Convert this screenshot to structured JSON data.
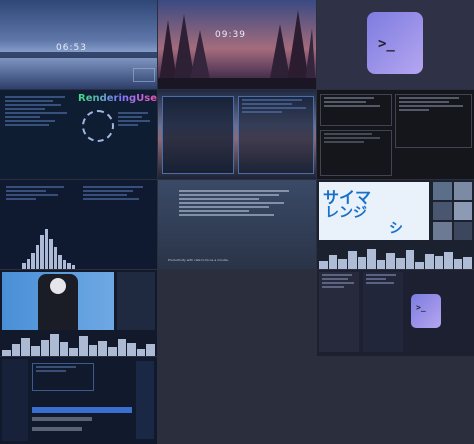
{
  "gallery": {
    "tiles": [
      {
        "name": "lockscreen-lake",
        "clock": "06:53"
      },
      {
        "name": "forest-sunset",
        "clock": "09:39"
      },
      {
        "name": "terminal-logo",
        "label": ">_"
      },
      {
        "name": "renderingouser-desktop",
        "title": "RenderingUser"
      },
      {
        "name": "city-dusk-terminals"
      },
      {
        "name": "dark-file-manager"
      },
      {
        "name": "visualizer-editor"
      },
      {
        "name": "docs-page",
        "footer": "Productivity with cafe to focus a minute."
      },
      {
        "name": "japanese-poster",
        "title_lines": [
          "サイマ",
          "レンジ",
          "シ"
        ]
      },
      {
        "name": "anime-tea-visualizer"
      },
      {
        "name": "chat-and-launcher",
        "label": ">_"
      },
      {
        "name": "settings-and-widgets"
      }
    ]
  },
  "colors": {
    "bg": "#2b2e3c",
    "accent": "#5a86d8",
    "title_gradient": [
      "#3ee07a",
      "#7f7bff",
      "#ff4fa8"
    ]
  }
}
